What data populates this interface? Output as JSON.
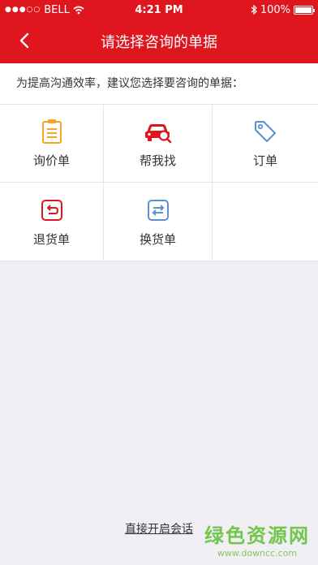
{
  "status_bar": {
    "carrier": "BELL",
    "time": "4:21 PM",
    "battery": "100%",
    "battery_level": 1.0
  },
  "navbar": {
    "title": "请选择咨询的单据",
    "back_icon": "chevron-left-icon"
  },
  "hint": "为提高沟通效率，建议您选择要咨询的单据：",
  "options": [
    {
      "label": "询价单",
      "icon": "clipboard-icon",
      "color": "#f5a623"
    },
    {
      "label": "帮我找",
      "icon": "car-search-icon",
      "color": "#e0161f"
    },
    {
      "label": "订单",
      "icon": "tag-icon",
      "color": "#5b8fd6"
    },
    {
      "label": "退货单",
      "icon": "return-icon",
      "color": "#e0161f"
    },
    {
      "label": "换货单",
      "icon": "exchange-icon",
      "color": "#5b8fd6"
    }
  ],
  "bottom_link": "直接开启会话",
  "watermark": {
    "text": "绿色资源网",
    "url": "www.downcc.com"
  },
  "colors": {
    "brand": "#e0161f",
    "background": "#efeff4"
  }
}
